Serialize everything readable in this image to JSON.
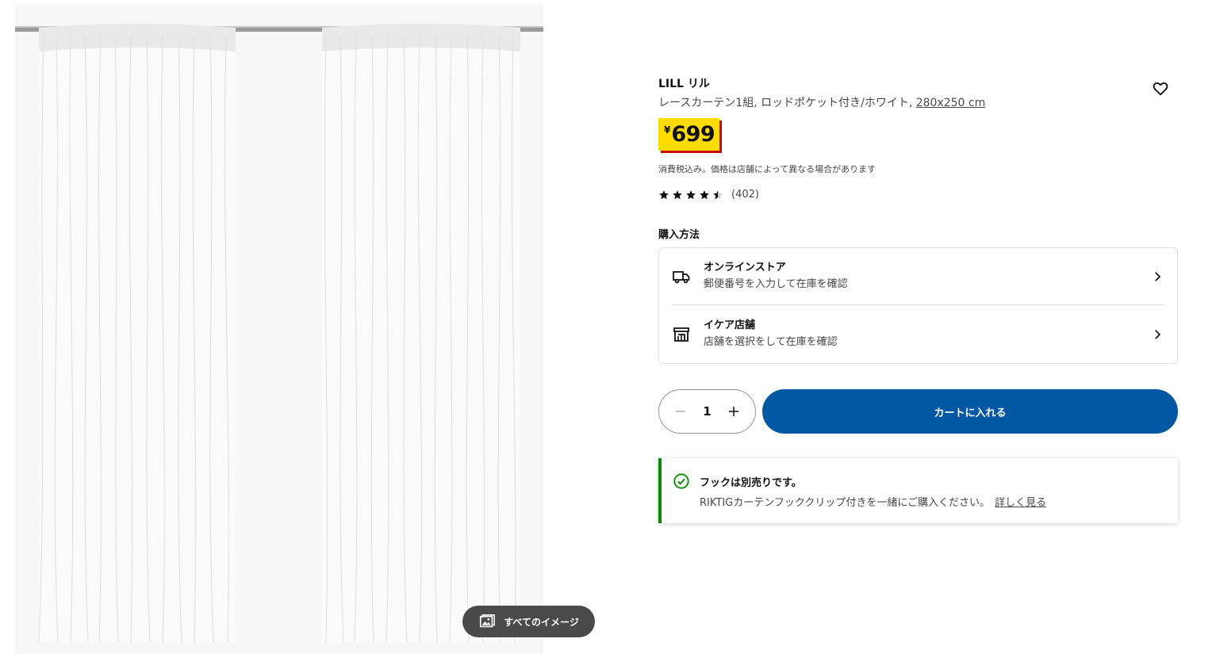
{
  "product": {
    "name": "LILL リル",
    "description": "レースカーテン1組, ロッドポケット付き/ホワイト, ",
    "size": "280x250 cm",
    "price_currency": "¥",
    "price_amount": "699",
    "tax_note": "消費税込み。価格は店舗によって異なる場合があります",
    "rating_value": 4.5,
    "rating_count": "(402)"
  },
  "media": {
    "all_images_label": "すべてのイメージ"
  },
  "purchase": {
    "heading": "購入方法",
    "options": [
      {
        "title": "オンラインストア",
        "subtitle": "郵便番号を入力して在庫を確認",
        "icon": "truck-icon"
      },
      {
        "title": "イケア店舗",
        "subtitle": "店舗を選択をして在庫を確認",
        "icon": "store-icon"
      }
    ]
  },
  "cart": {
    "quantity": "1",
    "add_label": "カートに入れる"
  },
  "notice": {
    "title": "フックは別売りです。",
    "body": "RIKTIGカーテンフッククリップ付きを一緒にご購入ください。",
    "link": "詳しく見る"
  },
  "colors": {
    "price_bg": "#ffdb00",
    "price_shadow": "#cc0008",
    "primary_button": "#0058a3",
    "notice_accent": "#0a8a00"
  }
}
